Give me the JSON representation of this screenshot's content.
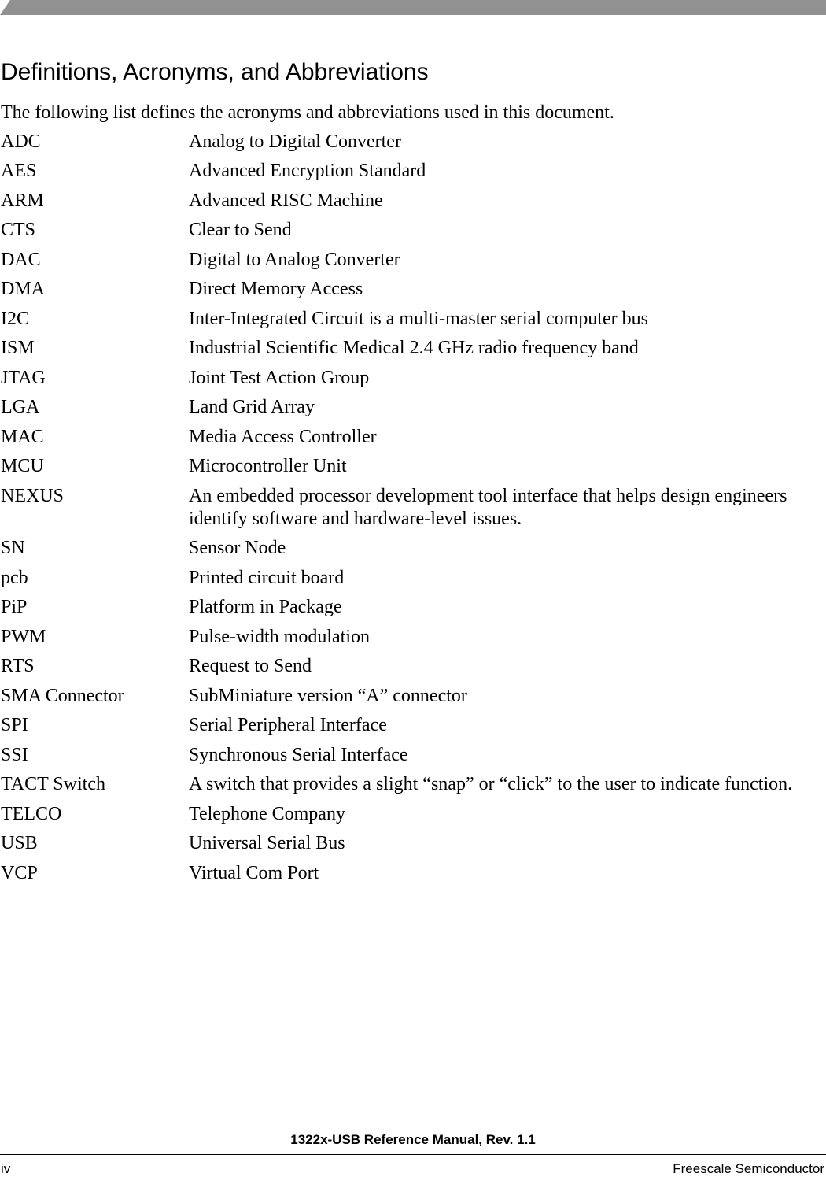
{
  "header": {
    "title": "Definitions, Acronyms, and Abbreviations",
    "intro": "The following list defines the acronyms and abbreviations used in this document."
  },
  "glossary": [
    {
      "term": "ADC",
      "definition": "Analog to Digital Converter"
    },
    {
      "term": "AES",
      "definition": "Advanced Encryption Standard"
    },
    {
      "term": "ARM",
      "definition": "Advanced RISC Machine"
    },
    {
      "term": "CTS",
      "definition": "Clear to Send"
    },
    {
      "term": "DAC",
      "definition": "Digital to Analog Converter"
    },
    {
      "term": "DMA",
      "definition": "Direct Memory Access"
    },
    {
      "term": "I2C",
      "definition": "Inter-Integrated Circuit is a multi-master serial computer bus"
    },
    {
      "term": "ISM",
      "definition": "Industrial Scientific Medical 2.4 GHz radio frequency band"
    },
    {
      "term": "JTAG",
      "definition": "Joint Test Action Group"
    },
    {
      "term": "LGA",
      "definition": "Land Grid Array"
    },
    {
      "term": "MAC",
      "definition": "Media Access Controller"
    },
    {
      "term": "MCU",
      "definition": "Microcontroller Unit"
    },
    {
      "term": "NEXUS",
      "definition": "An embedded processor development tool interface that helps design engineers identify software and hardware-level issues."
    },
    {
      "term": "SN",
      "definition": "Sensor Node"
    },
    {
      "term": "pcb",
      "definition": "Printed circuit board"
    },
    {
      "term": "PiP",
      "definition": "Platform in Package"
    },
    {
      "term": "PWM",
      "definition": "Pulse-width modulation"
    },
    {
      "term": "RTS",
      "definition": "Request to Send"
    },
    {
      "term": "SMA Connector",
      "definition": "SubMiniature version “A” connector"
    },
    {
      "term": "SPI",
      "definition": "Serial Peripheral Interface"
    },
    {
      "term": "SSI",
      "definition": "Synchronous Serial Interface"
    },
    {
      "term": "TACT Switch",
      "definition": "A switch that provides a slight “snap” or “click” to the user to indicate function."
    },
    {
      "term": "TELCO",
      "definition": "Telephone Company"
    },
    {
      "term": "USB",
      "definition": "Universal Serial Bus"
    },
    {
      "term": "VCP",
      "definition": "Virtual Com Port"
    }
  ],
  "footer": {
    "document_title": "1322x-USB Reference Manual, Rev. 1.1",
    "page_number": "iv",
    "company": "Freescale Semiconductor"
  }
}
